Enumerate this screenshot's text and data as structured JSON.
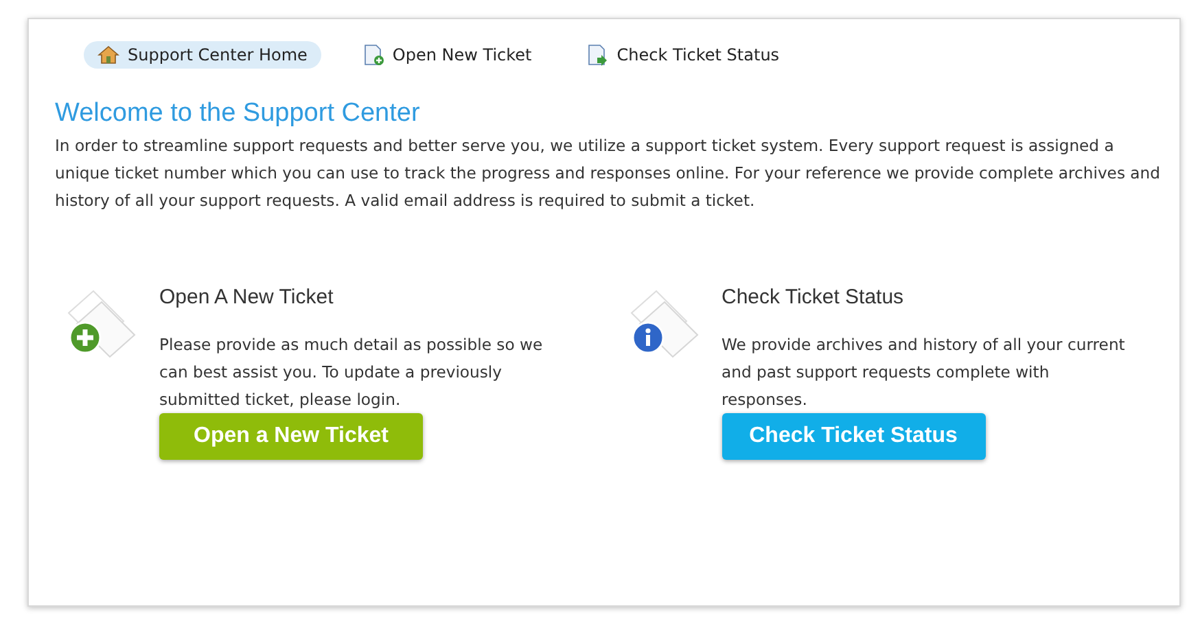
{
  "nav": [
    {
      "label": "Support Center Home",
      "kind": "home",
      "selected": true
    },
    {
      "label": "Open New Ticket",
      "kind": "new",
      "selected": false
    },
    {
      "label": "Check Ticket Status",
      "kind": "status",
      "selected": false
    }
  ],
  "title": "Welcome to the Support Center",
  "intro": "In order to streamline support requests and better serve you, we utilize a support ticket system. Every support request is assigned a unique ticket number which you can use to track the progress and responses online. For your reference we provide complete archives and history of all your support requests. A valid email address is required to submit a ticket.",
  "cards": [
    {
      "kind": "open",
      "heading": "Open A New Ticket",
      "text": "Please provide as much detail as possible so we can best assist you. To update a previously submitted ticket, please login.",
      "button": "Open a New Ticket"
    },
    {
      "kind": "status",
      "heading": "Check Ticket Status",
      "text": "We provide archives and history of all your current and past support requests complete with responses.",
      "button": "Check Ticket Status"
    }
  ]
}
